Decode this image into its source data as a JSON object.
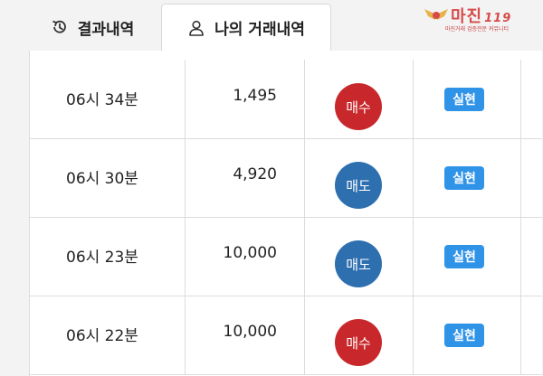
{
  "tabs": [
    {
      "label": "결과내역",
      "icon": "history-icon",
      "active": false
    },
    {
      "label": "나의 거래내역",
      "icon": "user-icon",
      "active": true
    }
  ],
  "logo": {
    "title": "마진",
    "title_suffix": "119",
    "subtitle": "마진거래 검증전문 커뮤니티"
  },
  "colors": {
    "buy": "#c8282b",
    "sell": "#2e6fb0",
    "status_badge": "#2f93e8"
  },
  "trades": [
    {
      "time": "06시 34분",
      "amount": "1,495",
      "side": "매수",
      "side_type": "buy",
      "status": "실현"
    },
    {
      "time": "06시 30분",
      "amount": "4,920",
      "side": "매도",
      "side_type": "sell",
      "status": "실현"
    },
    {
      "time": "06시 23분",
      "amount": "10,000",
      "side": "매도",
      "side_type": "sell",
      "status": "실현"
    },
    {
      "time": "06시 22분",
      "amount": "10,000",
      "side": "매수",
      "side_type": "buy",
      "status": "실현"
    }
  ]
}
